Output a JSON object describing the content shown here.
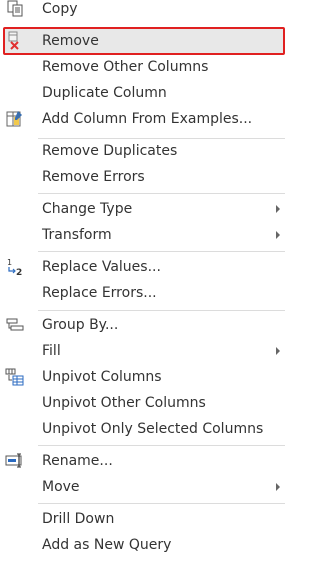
{
  "menu": {
    "items": [
      {
        "label": "Copy",
        "icon": "copy-icon"
      },
      {
        "label": "Remove",
        "icon": "remove-column-icon"
      },
      {
        "label": "Remove Other Columns"
      },
      {
        "label": "Duplicate Column"
      },
      {
        "label": "Add Column From Examples...",
        "icon": "column-from-examples-icon"
      },
      {
        "label": "Remove Duplicates"
      },
      {
        "label": "Remove Errors"
      },
      {
        "label": "Change Type",
        "submenu": true
      },
      {
        "label": "Transform",
        "submenu": true
      },
      {
        "label": "Replace Values...",
        "icon": "replace-values-icon"
      },
      {
        "label": "Replace Errors..."
      },
      {
        "label": "Group By...",
        "icon": "group-by-icon"
      },
      {
        "label": "Fill",
        "submenu": true
      },
      {
        "label": "Unpivot Columns",
        "icon": "unpivot-icon"
      },
      {
        "label": "Unpivot Other Columns"
      },
      {
        "label": "Unpivot Only Selected Columns"
      },
      {
        "label": "Rename...",
        "icon": "rename-icon"
      },
      {
        "label": "Move",
        "submenu": true
      },
      {
        "label": "Drill Down"
      },
      {
        "label": "Add as New Query"
      }
    ]
  },
  "colors": {
    "highlight_border": "#e02020",
    "highlight_fill": "#e8e8e8",
    "text": "#333333",
    "separator": "#dcdcdc"
  }
}
